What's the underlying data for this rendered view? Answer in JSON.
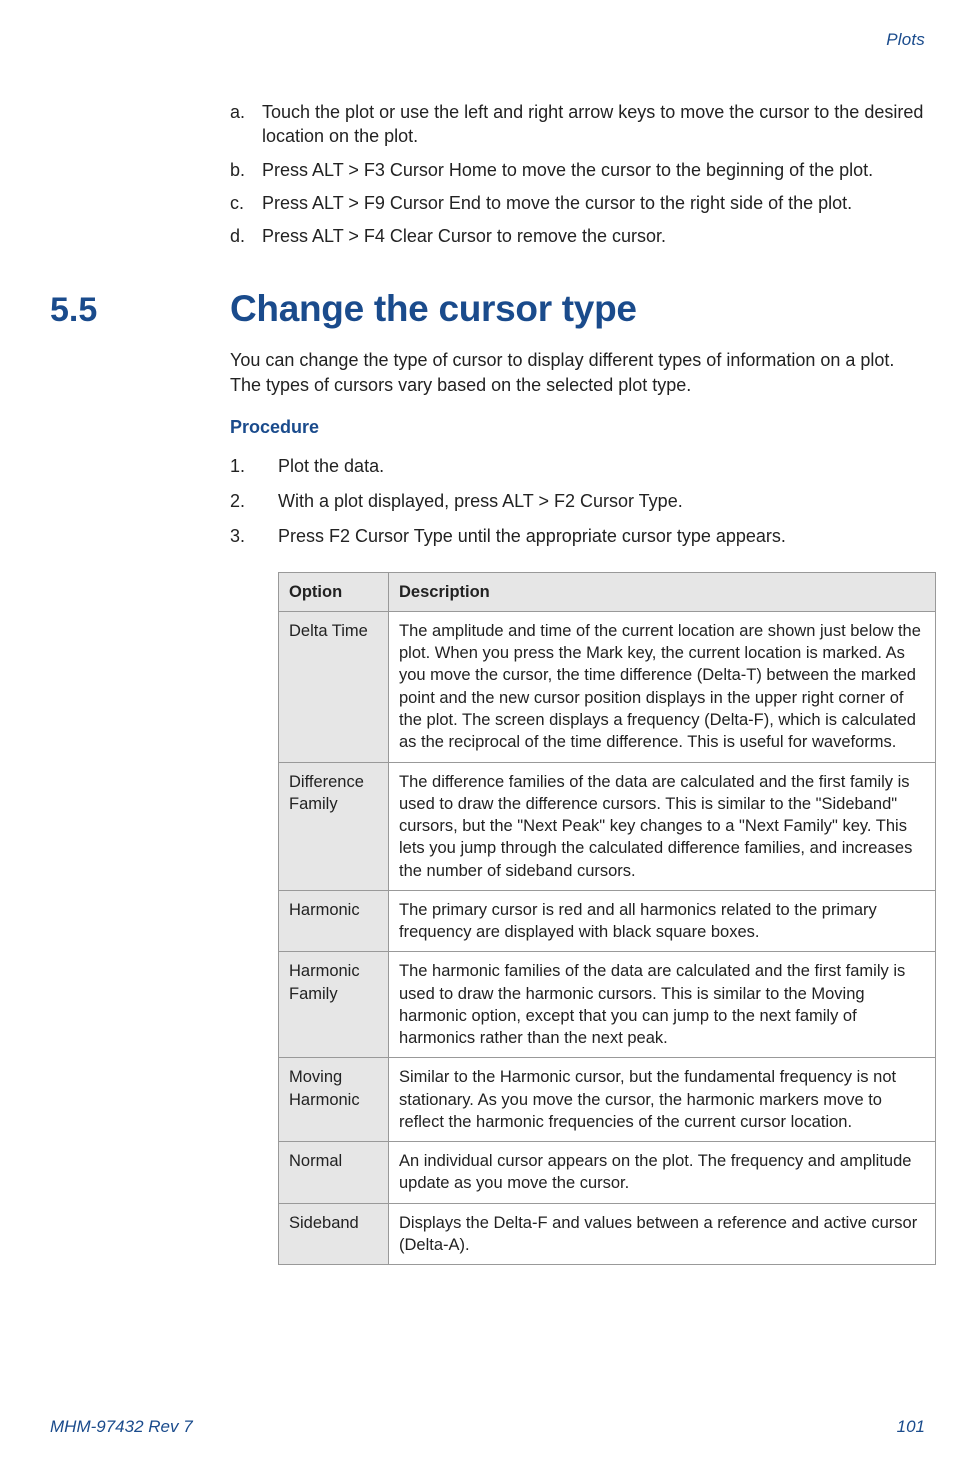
{
  "header": {
    "section": "Plots"
  },
  "sublist": {
    "a": {
      "marker": "a.",
      "pre": "Touch the plot or use the left and right arrow keys to move the cursor to the desired location on the plot."
    },
    "b": {
      "marker": "b.",
      "pre": "Press ALT > ",
      "ui": "F3 Cursor Home",
      "post": " to move the cursor to the beginning of the plot."
    },
    "c": {
      "marker": "c.",
      "pre": "Press ALT > ",
      "ui": "F9 Cursor End",
      "post": " to move the cursor to the right side of the plot."
    },
    "d": {
      "marker": "d.",
      "pre": "Press ALT > ",
      "ui": "F4 Clear Cursor",
      "post": " to remove the cursor."
    }
  },
  "section": {
    "number": "5.5",
    "title": "Change the cursor type",
    "intro": "You can change the type of cursor to display different types of information on a plot. The types of cursors vary based on the selected plot type.",
    "procedure_label": "Procedure"
  },
  "steps": {
    "s1": {
      "marker": "1.",
      "body": "Plot the data."
    },
    "s2": {
      "marker": "2.",
      "pre": "With a plot displayed, press ALT > ",
      "ui": "F2 Cursor Type",
      "post": "."
    },
    "s3": {
      "marker": "3.",
      "pre": "Press ",
      "ui": "F2 Cursor Type",
      "post": " until the appropriate cursor type appears."
    }
  },
  "table": {
    "headers": {
      "option": "Option",
      "description": "Description"
    },
    "rows": {
      "r1": {
        "option": "Delta Time",
        "desc": "The amplitude and time of the current location are shown just below the plot. When you press the Mark key, the current location is marked. As you move the cursor, the time difference (Delta-T) between the marked point and the new cursor position displays in the upper right corner of the plot. The screen displays a frequency (Delta-F), which is calculated as the reciprocal of the time difference. This is useful for waveforms."
      },
      "r2": {
        "option": "Difference Family",
        "desc": "The difference families of the data are calculated and the first family is used to draw the difference cursors. This is similar to the \"Sideband\" cursors, but the \"Next Peak\" key changes to a \"Next Family\" key. This lets you jump through the calculated difference families, and increases the number of sideband cursors."
      },
      "r3": {
        "option": "Harmonic",
        "desc": "The primary cursor is red and all harmonics related to the primary frequency are displayed with black square boxes."
      },
      "r4": {
        "option": "Harmonic Family",
        "desc": "The harmonic families of the data are calculated and the first family is used to draw the harmonic cursors. This is similar to the Moving harmonic option, except that you can jump to the next family of harmonics rather than the next peak."
      },
      "r5": {
        "option": "Moving Harmonic",
        "desc": "Similar to the Harmonic cursor, but the fundamental frequency is not stationary. As you move the cursor, the harmonic markers move to reflect the harmonic frequencies of the current cursor location."
      },
      "r6": {
        "option": "Normal",
        "desc": "An individual cursor appears on the plot. The frequency and amplitude update as you move the cursor."
      },
      "r7": {
        "option": "Sideband",
        "desc": "Displays the Delta-F and values between a reference and active cursor (Delta-A)."
      }
    }
  },
  "footer": {
    "left": "MHM-97432 Rev 7",
    "right": "101"
  }
}
